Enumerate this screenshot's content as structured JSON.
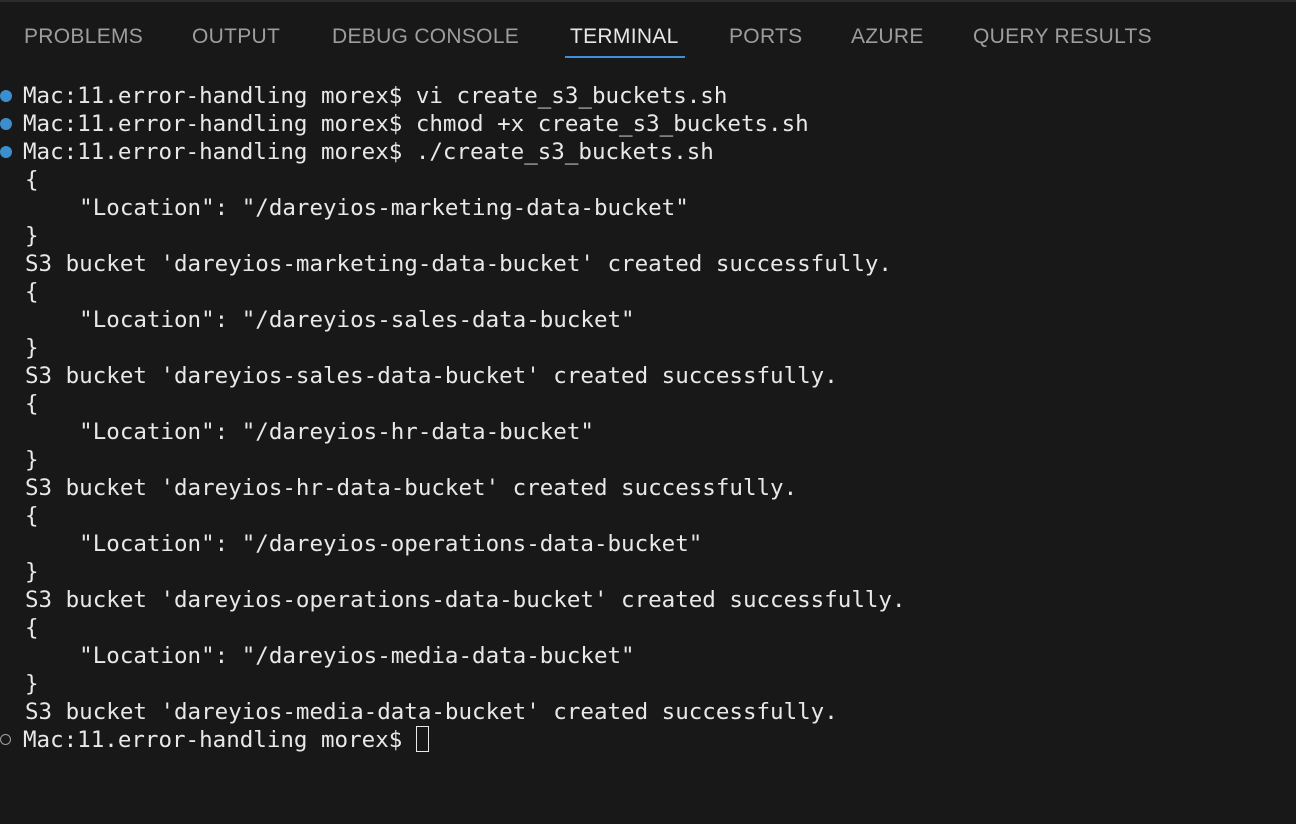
{
  "tabs": [
    {
      "label": "PROBLEMS",
      "active": false
    },
    {
      "label": "OUTPUT",
      "active": false
    },
    {
      "label": "DEBUG CONSOLE",
      "active": false
    },
    {
      "label": "TERMINAL",
      "active": true
    },
    {
      "label": "PORTS",
      "active": false
    },
    {
      "label": "AZURE",
      "active": false
    },
    {
      "label": "QUERY RESULTS",
      "active": false
    }
  ],
  "colors": {
    "background": "#181818",
    "accent": "#3e8fd6",
    "success_dot": "#3b8fce"
  },
  "terminal": {
    "prompt": "Mac:11.error-handling morex$",
    "commands": [
      " vi create_s3_buckets.sh",
      " chmod +x create_s3_buckets.sh",
      " ./create_s3_buckets.sh"
    ],
    "output": [
      "{",
      "    \"Location\": \"/dareyios-marketing-data-bucket\"",
      "}",
      "S3 bucket 'dareyios-marketing-data-bucket' created successfully.",
      "{",
      "    \"Location\": \"/dareyios-sales-data-bucket\"",
      "}",
      "S3 bucket 'dareyios-sales-data-bucket' created successfully.",
      "{",
      "    \"Location\": \"/dareyios-hr-data-bucket\"",
      "}",
      "S3 bucket 'dareyios-hr-data-bucket' created successfully.",
      "{",
      "    \"Location\": \"/dareyios-operations-data-bucket\"",
      "}",
      "S3 bucket 'dareyios-operations-data-bucket' created successfully.",
      "{",
      "    \"Location\": \"/dareyios-media-data-bucket\"",
      "}",
      "S3 bucket 'dareyios-media-data-bucket' created successfully."
    ],
    "final_prompt": "Mac:11.error-handling morex$ "
  }
}
